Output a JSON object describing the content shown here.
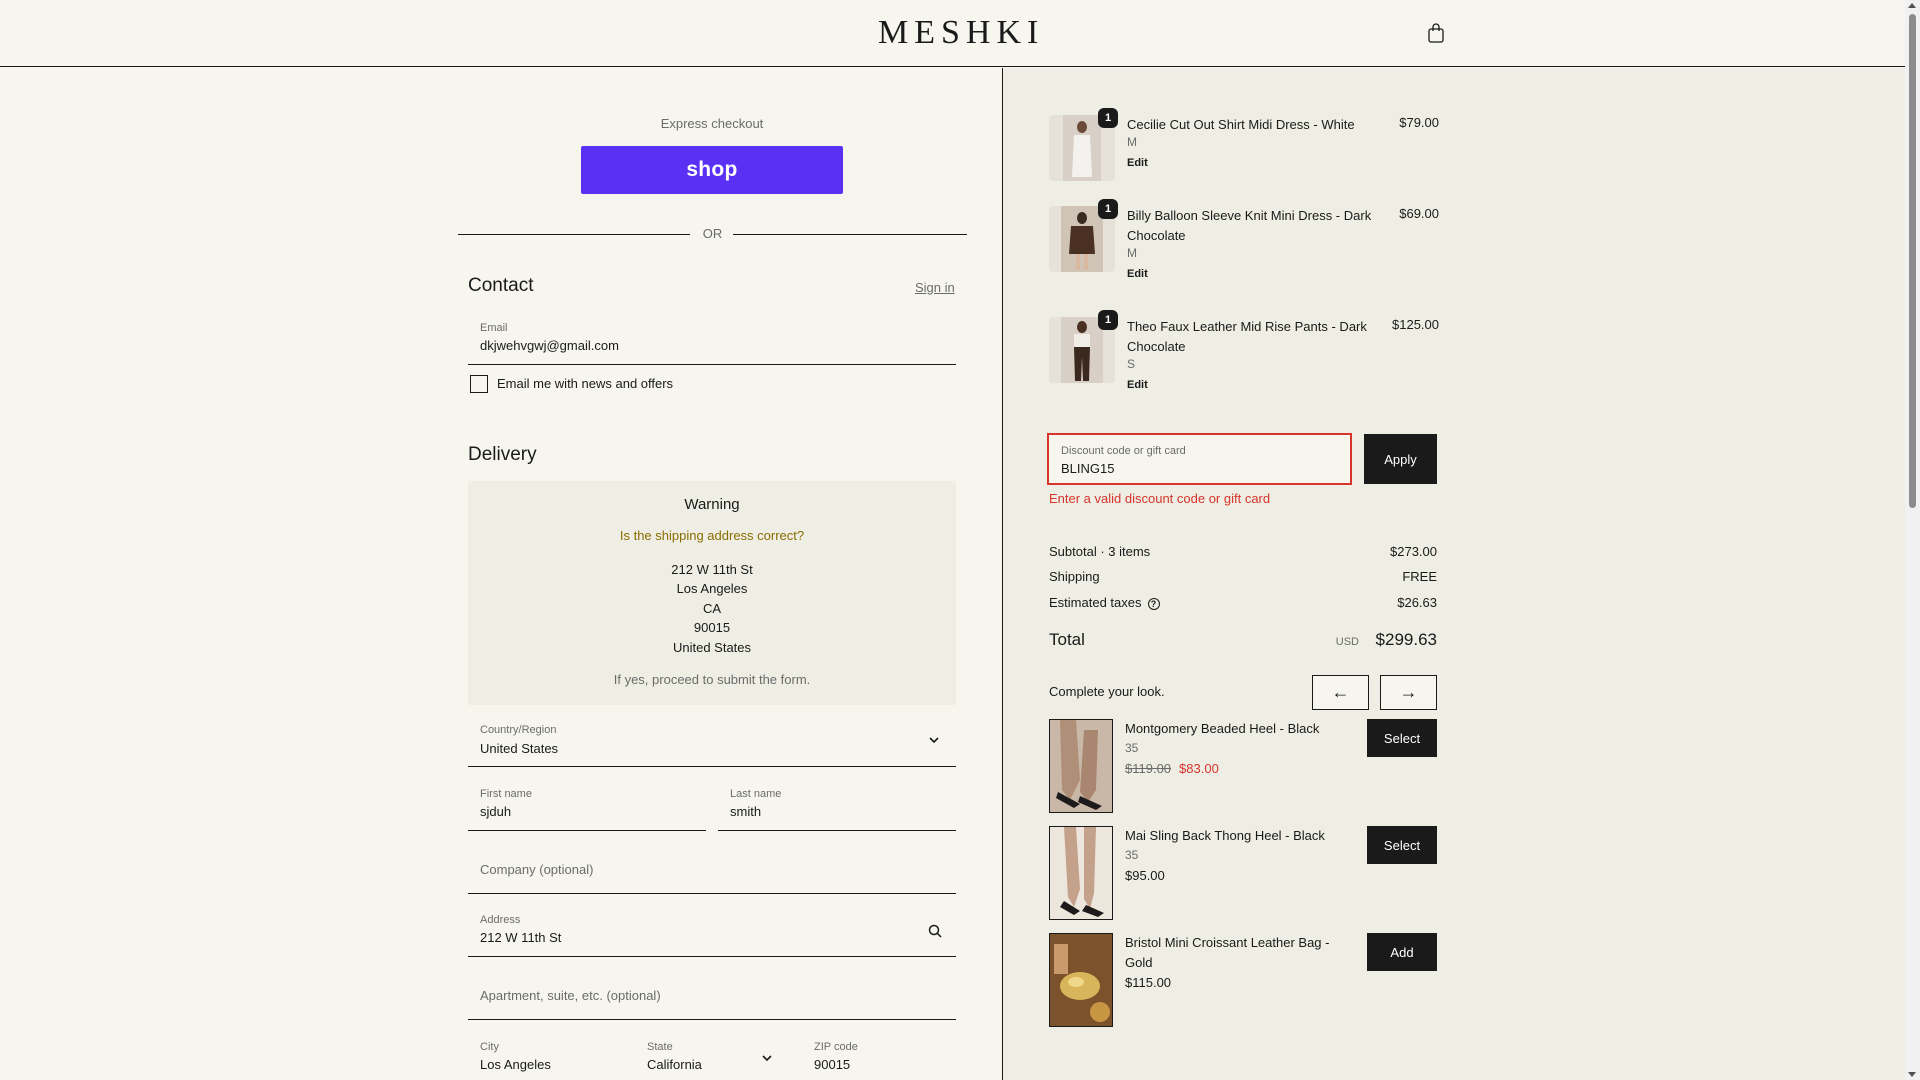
{
  "header": {
    "logo": "MESHKI",
    "cart_icon": "shopping-bag-icon"
  },
  "express": {
    "label": "Express checkout",
    "shop_button": "shop",
    "or_label": "OR"
  },
  "contact": {
    "title": "Contact",
    "sign_in": "Sign in",
    "email_label": "Email",
    "email_value": "dkjwehvgwj@gmail.com",
    "newsletter_label": "Email me with news and offers"
  },
  "delivery": {
    "title": "Delivery",
    "warning": {
      "title": "Warning",
      "question": "Is the shipping address correct?",
      "address_lines": [
        "212 W 11th St",
        "Los Angeles",
        "CA",
        "90015",
        "United States"
      ],
      "note": "If yes, proceed to submit the form."
    },
    "country_label": "Country/Region",
    "country_value": "United States",
    "first_name_label": "First name",
    "first_name_value": "sjduh",
    "last_name_label": "Last name",
    "last_name_value": "smith",
    "company_placeholder": "Company (optional)",
    "address_label": "Address",
    "address_value": "212 W 11th St",
    "apartment_placeholder": "Apartment, suite, etc. (optional)",
    "city_label": "City",
    "city_value": "Los Angeles",
    "state_label": "State",
    "state_value": "California",
    "zip_label": "ZIP code",
    "zip_value": "90015"
  },
  "cart": {
    "items": [
      {
        "name": "Cecilie Cut Out Shirt Midi Dress - White",
        "variant": "M",
        "qty": "1",
        "price": "$79.00",
        "edit": "Edit"
      },
      {
        "name": "Billy Balloon Sleeve Knit Mini Dress - Dark Chocolate",
        "variant": "M",
        "qty": "1",
        "price": "$69.00",
        "edit": "Edit"
      },
      {
        "name": "Theo Faux Leather Mid Rise Pants - Dark Chocolate",
        "variant": "S",
        "qty": "1",
        "price": "$125.00",
        "edit": "Edit"
      }
    ],
    "discount_label": "Discount code or gift card",
    "discount_value": "BLING15",
    "apply": "Apply",
    "discount_error": "Enter a valid discount code or gift card",
    "subtotal_label": "Subtotal · 3 items",
    "subtotal_value": "$273.00",
    "shipping_label": "Shipping",
    "shipping_value": "FREE",
    "taxes_label": "Estimated taxes",
    "taxes_value": "$26.63",
    "total_label": "Total",
    "total_currency": "USD",
    "total_value": "$299.63"
  },
  "look": {
    "title": "Complete your look.",
    "prev": "←",
    "next": "→",
    "items": [
      {
        "name": "Montgomery Beaded Heel - Black",
        "size": "35",
        "old_price": "$119.00",
        "price": "$83.00",
        "button": "Select"
      },
      {
        "name": "Mai Sling Back Thong Heel - Black",
        "size": "35",
        "price": "$95.00",
        "button": "Select"
      },
      {
        "name": "Bristol Mini Croissant Leather Bag - Gold",
        "price": "$115.00",
        "button": "Add"
      }
    ]
  },
  "colors": {
    "shop_pay": "#5a31f4",
    "error": "#d7342c",
    "warning_text": "#8a6d00",
    "dark": "#1a1a1a"
  }
}
